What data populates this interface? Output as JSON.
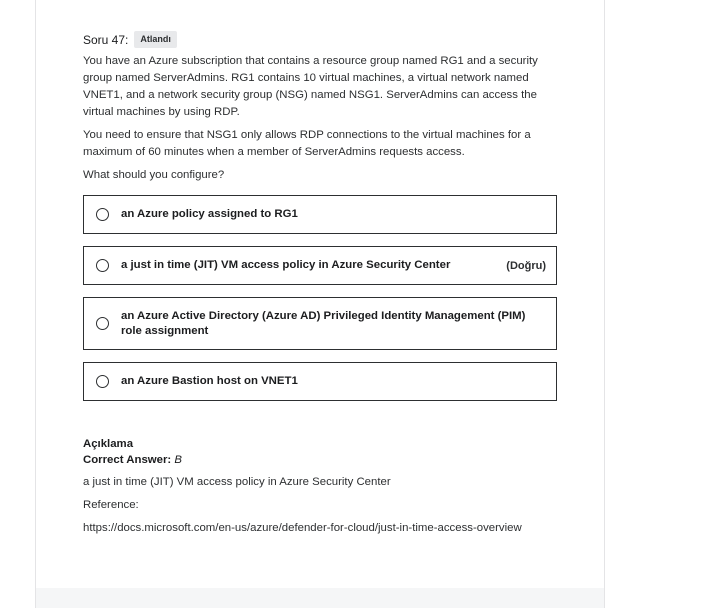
{
  "question": {
    "label": "Soru 47:",
    "status_badge": "Atlandı",
    "paragraphs": [
      "You have an Azure subscription that contains a resource group named RG1 and a security group named ServerAdmins. RG1 contains 10 virtual machines, a virtual network named VNET1, and a network security group (NSG) named NSG1. ServerAdmins can access the virtual machines by using RDP.",
      "You need to ensure that NSG1 only allows RDP connections to the virtual machines for a maximum of 60 minutes when a member of ServerAdmins requests access.",
      "What should you configure?"
    ]
  },
  "options": [
    {
      "text": "an Azure policy assigned to RG1",
      "tag": ""
    },
    {
      "text": "a just in time (JIT) VM access policy in Azure Security Center",
      "tag": "(Doğru)"
    },
    {
      "text": "an Azure Active Directory (Azure AD) Privileged Identity Management (PIM) role assignment",
      "tag": ""
    },
    {
      "text": "an Azure Bastion host on VNET1",
      "tag": ""
    }
  ],
  "explanation": {
    "title": "Açıklama",
    "correct_label": "Correct Answer:",
    "correct_value": "B",
    "answer_text": "a just in time (JIT) VM access policy in Azure Security Center",
    "reference_label": "Reference:",
    "reference_url": "https://docs.microsoft.com/en-us/azure/defender-for-cloud/just-in-time-access-overview"
  }
}
